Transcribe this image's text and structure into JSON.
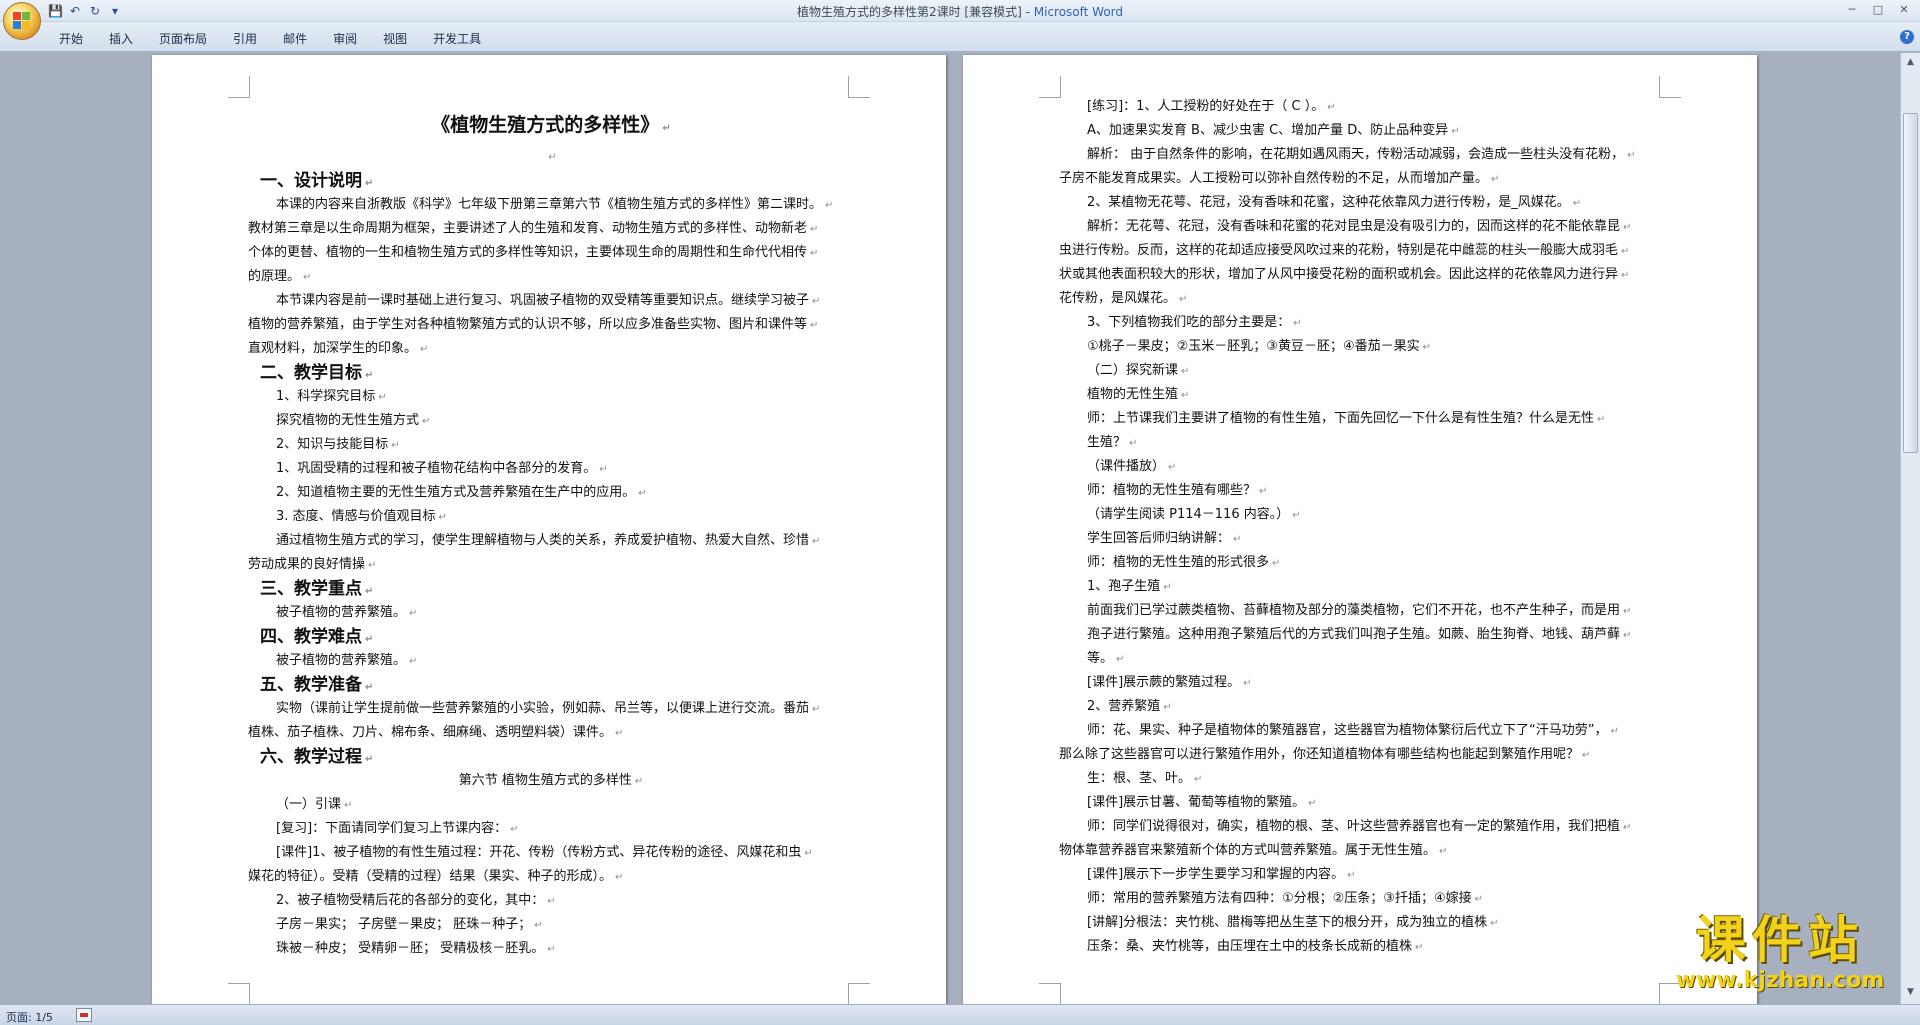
{
  "window": {
    "doc_title": "植物生殖方式的多样性第2课时 [兼容模式] - ",
    "app_name": "Microsoft Word"
  },
  "ribbon": {
    "tabs": [
      "开始",
      "插入",
      "页面布局",
      "引用",
      "邮件",
      "审阅",
      "视图",
      "开发工具"
    ]
  },
  "status": {
    "page": "页面: 1/5"
  },
  "watermark": {
    "main": "课件站",
    "url": "www.kjzhan.com"
  },
  "page_left": {
    "title": "《植物生殖方式的多样性》",
    "lines": [
      {
        "t": "一、设计说明",
        "c": "h1"
      },
      {
        "t": "本课的内容来自浙教版《科学》七年级下册第三章第六节《植物生殖方式的多样性》第二课时。",
        "c": "ind1"
      },
      {
        "t": "教材第三章是以生命周期为框架，主要讲述了人的生殖和发育、动物生殖方式的多样性、动物新老",
        "c": ""
      },
      {
        "t": "个体的更替、植物的一生和植物生殖方式的多样性等知识，主要体现生命的周期性和生命代代相传",
        "c": ""
      },
      {
        "t": "的原理。",
        "c": ""
      },
      {
        "t": "本节课内容是前一课时基础上进行复习、巩固被子植物的双受精等重要知识点。继续学习被子",
        "c": "ind1"
      },
      {
        "t": "植物的营养繁殖，由于学生对各种植物繁殖方式的认识不够，所以应多准备些实物、图片和课件等",
        "c": ""
      },
      {
        "t": "直观材料，加深学生的印象。",
        "c": ""
      },
      {
        "t": "二、教学目标",
        "c": "h1"
      },
      {
        "t": "1、科学探究目标",
        "c": "ind1"
      },
      {
        "t": "探究植物的无性生殖方式",
        "c": "ind1"
      },
      {
        "t": "2、知识与技能目标",
        "c": "ind1"
      },
      {
        "t": "1、巩固受精的过程和被子植物花结构中各部分的发育。",
        "c": "ind1"
      },
      {
        "t": "2、知道植物主要的无性生殖方式及营养繁殖在生产中的应用。",
        "c": "ind1"
      },
      {
        "t": "3. 态度、情感与价值观目标",
        "c": "ind1"
      },
      {
        "t": "通过植物生殖方式的学习，使学生理解植物与人类的关系，养成爱护植物、热爱大自然、珍惜",
        "c": "ind1"
      },
      {
        "t": "劳动成果的良好情操",
        "c": ""
      },
      {
        "t": "三、教学重点",
        "c": "h1"
      },
      {
        "t": "被子植物的营养繁殖。",
        "c": "ind1"
      },
      {
        "t": "四、教学难点",
        "c": "h1"
      },
      {
        "t": "被子植物的营养繁殖。",
        "c": "ind1"
      },
      {
        "t": "五、教学准备",
        "c": "h1"
      },
      {
        "t": "实物（课前让学生提前做一些营养繁殖的小实验，例如蒜、吊兰等，以便课上进行交流。番茄",
        "c": "ind1"
      },
      {
        "t": "植株、茄子植株、刀片、棉布条、细麻绳、透明塑料袋）课件。",
        "c": ""
      },
      {
        "t": "六、教学过程",
        "c": "h1"
      },
      {
        "t": "第六节  植物生殖方式的多样性",
        "c": "center"
      },
      {
        "t": "（一）引课",
        "c": "ind1"
      },
      {
        "t": "[复习]：下面请同学们复习上节课内容：",
        "c": "ind1"
      },
      {
        "t": "[课件]1、被子植物的有性生殖过程：开花、传粉（传粉方式、异花传粉的途径、风媒花和虫",
        "c": "ind1"
      },
      {
        "t": "媒花的特征）。受精（受精的过程）结果（果实、种子的形成）。",
        "c": ""
      },
      {
        "t": "2、被子植物受精后花的各部分的变化，其中：",
        "c": "ind1"
      },
      {
        "t": "子房－果实；      子房壁－果皮；       胚珠－种子；",
        "c": "ind1"
      },
      {
        "t": "珠被－种皮；      受精卵－胚；         受精极核－胚乳。",
        "c": "ind1"
      }
    ]
  },
  "page_right": {
    "lines": [
      {
        "t": "[练习]：1、人工授粉的好处在于（        C        ）。",
        "c": "ind1"
      },
      {
        "t": "A、加速果实发育      B、减少虫害      C、增加产量      D、防止品种变异",
        "c": "ind1"
      },
      {
        "t": "解析：  由于自然条件的影响，在花期如遇风雨天，传粉活动减弱，会造成一些柱头没有花粉，",
        "c": "ind1"
      },
      {
        "t": "子房不能发育成果实。人工授粉可以弥补自然传粉的不足，从而增加产量。",
        "c": ""
      },
      {
        "t": "2、某植物无花萼、花冠，没有香味和花蜜，这种花依靠风力进行传粉，是_风媒花。",
        "c": "ind1"
      },
      {
        "t": "解析：无花萼、花冠，没有香味和花蜜的花对昆虫是没有吸引力的，因而这样的花不能依靠昆",
        "c": "ind1"
      },
      {
        "t": "虫进行传粉。反而，这样的花却适应接受风吹过来的花粉，特别是花中雌蕊的柱头一般膨大成羽毛",
        "c": ""
      },
      {
        "t": "状或其他表面积较大的形状，增加了从风中接受花粉的面积或机会。因此这样的花依靠风力进行异",
        "c": ""
      },
      {
        "t": "花传粉，是风媒花。",
        "c": ""
      },
      {
        "t": "3、下列植物我们吃的部分主要是：",
        "c": "ind1"
      },
      {
        "t": "①桃子－果皮；②玉米－胚乳；③黄豆－胚；④番茄－果实",
        "c": "ind1"
      },
      {
        "t": "（二）探究新课",
        "c": "ind1"
      },
      {
        "t": "植物的无性生殖",
        "c": "ind1"
      },
      {
        "t": "师：上节课我们主要讲了植物的有性生殖，下面先回忆一下什么是有性生殖？什么是无性",
        "c": "ind1"
      },
      {
        "t": "生殖？",
        "c": "ind1"
      },
      {
        "t": "（课件播放）",
        "c": "ind1"
      },
      {
        "t": "师：植物的无性生殖有哪些？",
        "c": "ind1"
      },
      {
        "t": "（请学生阅读 P114－116 内容。）",
        "c": "ind1"
      },
      {
        "t": "学生回答后师归纳讲解：",
        "c": "ind1"
      },
      {
        "t": "师：植物的无性生殖的形式很多",
        "c": "ind1"
      },
      {
        "t": "1、孢子生殖",
        "c": "ind1"
      },
      {
        "t": "前面我们已学过蕨类植物、苔藓植物及部分的藻类植物，它们不开花，也不产生种子，而是用",
        "c": "ind1"
      },
      {
        "t": "孢子进行繁殖。这种用孢子繁殖后代的方式我们叫孢子生殖。如蕨、胎生狗脊、地钱、葫芦藓",
        "c": "ind1"
      },
      {
        "t": "等。",
        "c": "ind1"
      },
      {
        "t": "[课件]展示蕨的繁殖过程。",
        "c": "ind1"
      },
      {
        "t": "2、营养繁殖",
        "c": "ind1"
      },
      {
        "t": "师：花、果实、种子是植物体的繁殖器官，这些器官为植物体繁衍后代立下了“汗马功劳”，",
        "c": "ind1"
      },
      {
        "t": "那么除了这些器官可以进行繁殖作用外，你还知道植物体有哪些结构也能起到繁殖作用呢？",
        "c": ""
      },
      {
        "t": "生：根、茎、叶。",
        "c": "ind1"
      },
      {
        "t": "[课件]展示甘薯、葡萄等植物的繁殖。",
        "c": "ind1"
      },
      {
        "t": "师：同学们说得很对，确实，植物的根、茎、叶这些营养器官也有一定的繁殖作用，我们把植",
        "c": "ind1"
      },
      {
        "t": "物体靠营养器官来繁殖新个体的方式叫营养繁殖。属于无性生殖。",
        "c": ""
      },
      {
        "t": "[课件]展示下一步学生要学习和掌握的内容。",
        "c": "ind1"
      },
      {
        "t": "师：常用的营养繁殖方法有四种：①分根；②压条；③扦插；④嫁接",
        "c": "ind1"
      },
      {
        "t": "[讲解]分根法：夹竹桃、腊梅等把丛生茎下的根分开，成为独立的植株",
        "c": "ind1"
      },
      {
        "t": "压条：桑、夹竹桃等，由压埋在土中的枝条长成新的植株",
        "c": "ind1"
      }
    ]
  }
}
